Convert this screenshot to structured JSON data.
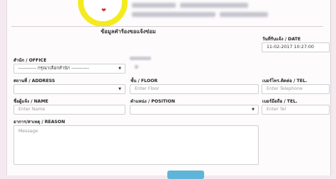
{
  "form": {
    "title": "ข้อมูลคำร้องขอแจ้งซ่อม",
    "date_label": "วันที่รับแจ้ง / DATE",
    "date_value": "11-02-2017 10:27:00",
    "office_label": "สำนัก / OFFICE",
    "office_selected": "----------- กรุณาเลือกสำนัก -----------",
    "address_label": "สถานที่ / ADDRESS",
    "floor_label": "ชั้น / FLOOR",
    "floor_placeholder": "Enter Floor",
    "telephone_label": "เบอร์โทร.ติดต่อ / TEL.",
    "telephone_placeholder": "Enter Telephone",
    "name_label": "ชื่อผู้แจ้ง / NAME",
    "name_placeholder": "Enter Name",
    "position_label": "ตำแหน่ง / POSITION",
    "mobile_label": "เบอร์มือถือ / TEL.",
    "mobile_placeholder": "Enter Tel",
    "reason_label": "อาการ/สาเหตุ / REASON",
    "reason_placeholder": "Message"
  },
  "icons": {
    "logo": "heart-logo-icon",
    "dropdown": "caret-down-icon"
  },
  "colors": {
    "logo_ring": "#f5ea1d",
    "heart": "#d62b2b",
    "submit_button": "#5fb5d8",
    "background": "#f3e9ee"
  }
}
